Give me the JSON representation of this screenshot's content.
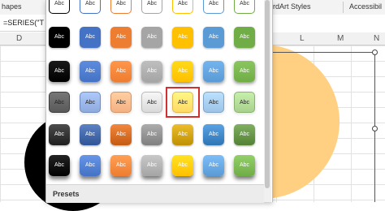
{
  "ribbon": {
    "left_label": "hapes",
    "wordart_label": "rdArt Styles",
    "accessibility_label": "Accessibil"
  },
  "formula_bar": {
    "text": "=SERIES(\"T"
  },
  "columns": {
    "left": "D",
    "right": [
      "L",
      "M",
      "N"
    ]
  },
  "gallery": {
    "tile_label": "Abc",
    "selected": {
      "row": 3,
      "col": 4
    },
    "section_label": "Presets",
    "column_colors": [
      "#000000",
      "#4472c4",
      "#ed7d31",
      "#a5a5a5",
      "#ffc000",
      "#5b9bd5",
      "#70ad47"
    ],
    "rows": [
      {
        "style": "outline",
        "fill": [
          "#ffffff",
          "#ffffff",
          "#ffffff",
          "#ffffff",
          "#ffffff",
          "#ffffff",
          "#ffffff"
        ],
        "text": "#333333"
      },
      {
        "style": "solid",
        "fill": [
          "#000000",
          "#4472c4",
          "#ed7d31",
          "#a5a5a5",
          "#ffc000",
          "#5b9bd5",
          "#70ad47"
        ],
        "text": "#ffffff"
      },
      {
        "style": "raised",
        "fill": [
          "#000000",
          "#4472c4",
          "#ed7d31",
          "#a5a5a5",
          "#ffc000",
          "#5b9bd5",
          "#70ad47"
        ],
        "text": "#ffffff"
      },
      {
        "style": "soft",
        "fill": [
          "#595959",
          "#8faadc",
          "#f4b183",
          "#d9d9d9",
          "#ffd966",
          "#9dc3e6",
          "#a9d18e"
        ],
        "text": "#222222"
      },
      {
        "style": "gradient",
        "fill": [
          "#1f1f1f",
          "#2f5597",
          "#c55a11",
          "#7f7f7f",
          "#bf9000",
          "#2e75b6",
          "#548235"
        ],
        "text": "#ffffff"
      },
      {
        "style": "shadowed",
        "fill": [
          "#000000",
          "#4472c4",
          "#ed7d31",
          "#a5a5a5",
          "#ffc000",
          "#5b9bd5",
          "#70ad47"
        ],
        "text": "#ffffff"
      }
    ]
  }
}
